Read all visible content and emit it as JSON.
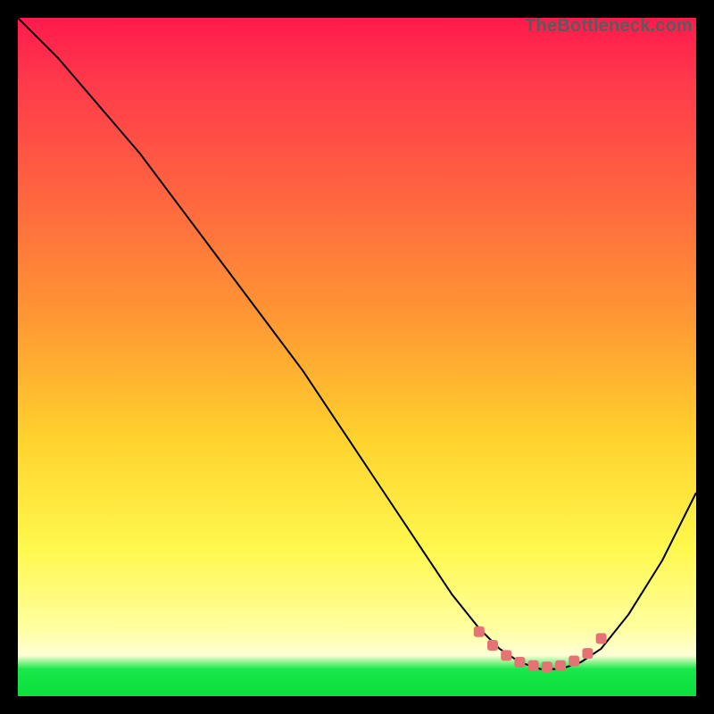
{
  "watermark": "TheBottleneck.com",
  "chart_data": {
    "type": "line",
    "title": "",
    "xlabel": "",
    "ylabel": "",
    "xlim": [
      0,
      100
    ],
    "ylim": [
      0,
      100
    ],
    "grid": false,
    "legend": false,
    "series": [
      {
        "name": "curve",
        "x": [
          0,
          6,
          12,
          18,
          24,
          30,
          36,
          42,
          48,
          54,
          60,
          64,
          68,
          71,
          74,
          77,
          80,
          83,
          86,
          90,
          95,
          100
        ],
        "y": [
          100,
          94,
          87,
          80,
          72,
          64,
          56,
          48,
          39,
          30,
          21,
          15,
          10,
          7,
          5,
          4,
          4,
          5,
          7,
          12,
          20,
          30
        ]
      },
      {
        "name": "flat-dots",
        "x": [
          68,
          70,
          72,
          74,
          76,
          78,
          80,
          82,
          84,
          86
        ],
        "y": [
          9.5,
          7.5,
          6.0,
          5.0,
          4.5,
          4.3,
          4.5,
          5.2,
          6.3,
          8.5
        ]
      }
    ],
    "colors": {
      "curve": "#000000",
      "dots": "#e57373",
      "gradient_top": "#ff1a4d",
      "gradient_bottom": "#0be03e"
    }
  }
}
